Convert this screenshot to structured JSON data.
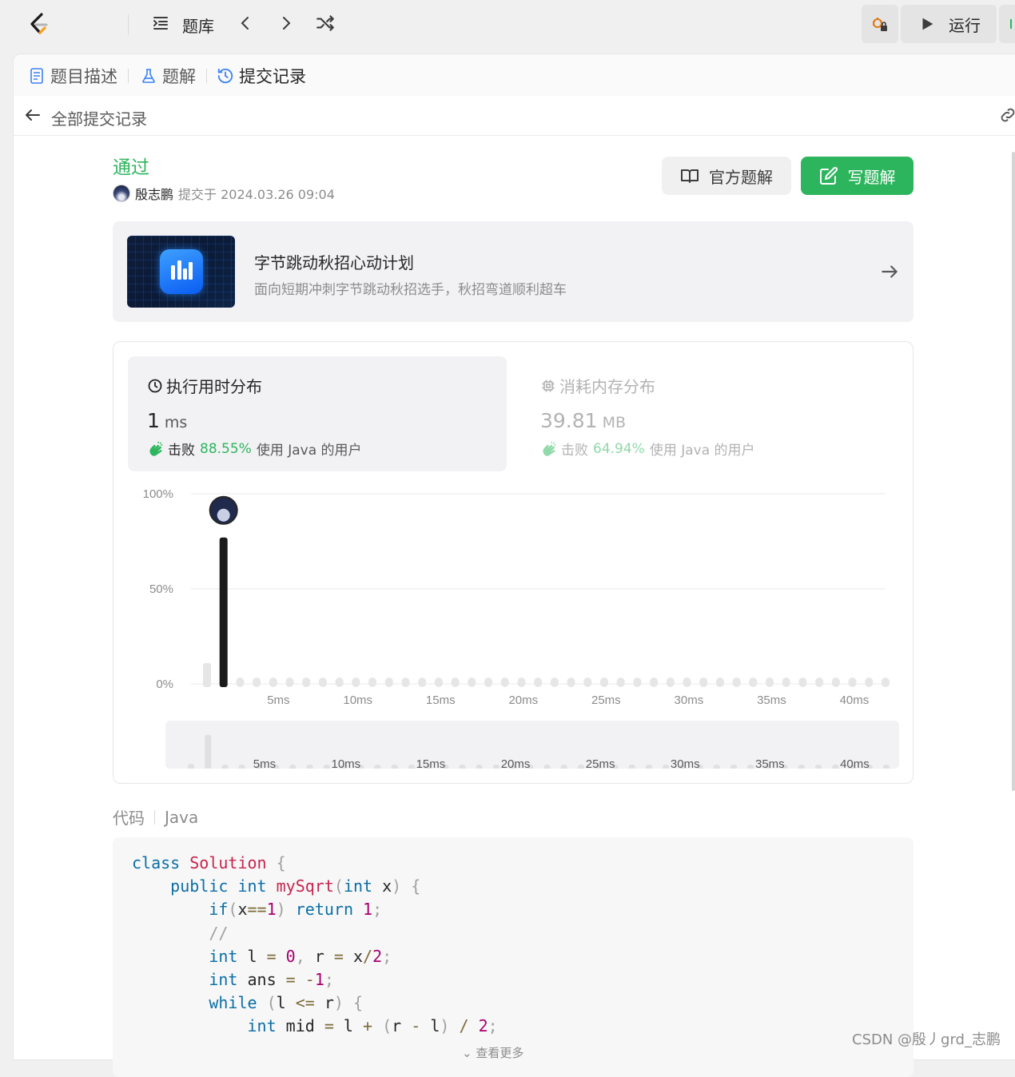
{
  "topbar": {
    "library_label": "题库",
    "run_label": "运行"
  },
  "tabs": [
    {
      "label": "题目描述"
    },
    {
      "label": "题解"
    },
    {
      "label": "提交记录"
    }
  ],
  "back": {
    "label": "全部提交记录"
  },
  "submission": {
    "status": "通过",
    "user": "殷志鹏",
    "submitted_text": "提交于 2024.03.26 09:04",
    "official_solution_label": "官方题解",
    "write_solution_label": "写题解"
  },
  "banner": {
    "title": "字节跳动秋招心动计划",
    "subtitle": "面向短期冲刺字节跳动秋招选手，秋招弯道顺利超车"
  },
  "runtime": {
    "title": "执行用时分布",
    "value": "1",
    "unit": "ms",
    "beat_prefix": "击败",
    "beat_pct": "88.55%",
    "beat_suffix": "使用 Java 的用户"
  },
  "memory": {
    "title": "消耗内存分布",
    "value": "39.81",
    "unit": "MB",
    "beat_prefix": "击败",
    "beat_pct": "64.94%",
    "beat_suffix": "使用 Java 的用户"
  },
  "chart_data": {
    "type": "bar",
    "title": "",
    "xlabel": "",
    "ylabel": "",
    "y_ticks": [
      "100%",
      "50%",
      "0%"
    ],
    "x_ticks": [
      "5ms",
      "10ms",
      "15ms",
      "20ms",
      "25ms",
      "30ms",
      "35ms",
      "40ms"
    ],
    "ylim": [
      0,
      100
    ],
    "x": [
      0,
      1,
      2,
      3,
      4,
      5,
      6,
      7,
      8,
      9,
      10,
      11,
      12,
      13,
      14,
      15,
      16,
      17,
      18,
      19,
      20,
      21,
      22,
      23,
      24,
      25,
      26,
      27,
      28,
      29,
      30,
      31,
      32,
      33,
      34,
      35,
      36,
      37,
      38,
      39,
      40,
      41
    ],
    "values": [
      11,
      77,
      0,
      0,
      0,
      0,
      0,
      0,
      0,
      0,
      0,
      0,
      0,
      0,
      0,
      0,
      0,
      0,
      0,
      0,
      0,
      0,
      0,
      0,
      0,
      0,
      0,
      0,
      0,
      0,
      0,
      0,
      0,
      0,
      0,
      0,
      0,
      0,
      0,
      0,
      0,
      0
    ],
    "highlight_x": 1,
    "grid": true
  },
  "code": {
    "label": "代码",
    "language": "Java",
    "more_label": "查看更多"
  },
  "watermark": "CSDN @殷丿grd_志鹏",
  "colors": {
    "accent": "#2db55d",
    "bar": "#1a1a1a",
    "bar_inactive": "#e6e6e6"
  }
}
